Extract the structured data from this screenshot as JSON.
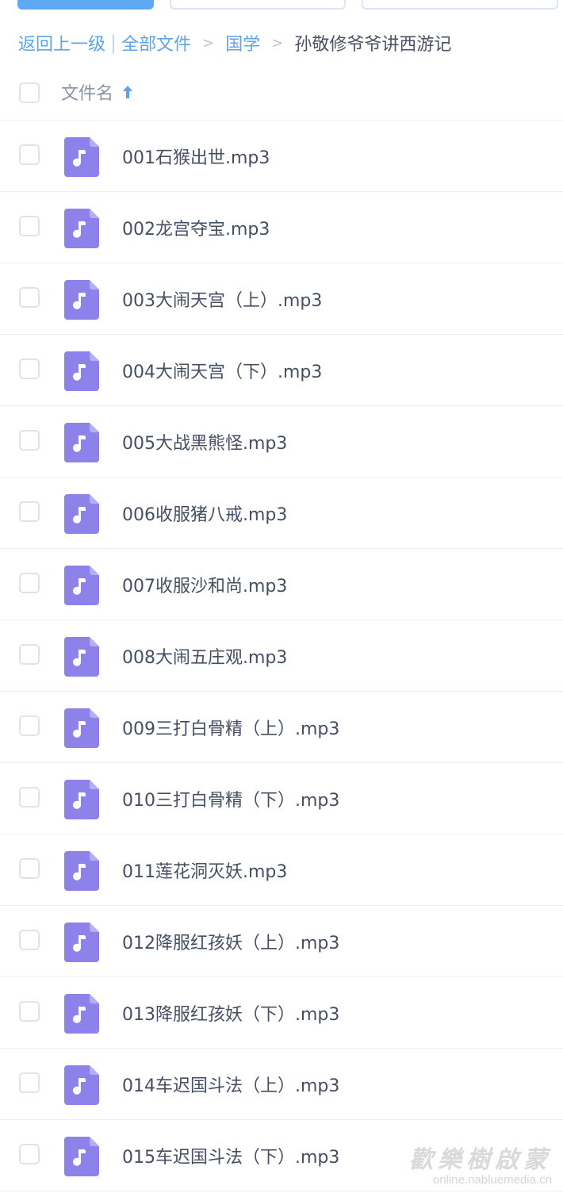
{
  "breadcrumb": {
    "back": "返回上一级",
    "all_files": "全部文件",
    "parent": "国学",
    "current": "孙敬修爷爷讲西游记",
    "separator": ">"
  },
  "header": {
    "name_column": "文件名",
    "sort_icon": "arrow-up-icon"
  },
  "file_icon": "music-file-icon",
  "colors": {
    "accent": "#5ea3ec",
    "file_icon": "#8c82ea"
  },
  "files": [
    {
      "name": "001石猴出世.mp3"
    },
    {
      "name": "002龙宫夺宝.mp3"
    },
    {
      "name": "003大闹天宫（上）.mp3"
    },
    {
      "name": "004大闹天宫（下）.mp3"
    },
    {
      "name": "005大战黑熊怪.mp3"
    },
    {
      "name": "006收服猪八戒.mp3"
    },
    {
      "name": "007收服沙和尚.mp3"
    },
    {
      "name": "008大闹五庄观.mp3"
    },
    {
      "name": "009三打白骨精（上）.mp3"
    },
    {
      "name": "010三打白骨精（下）.mp3"
    },
    {
      "name": "011莲花洞灭妖.mp3"
    },
    {
      "name": "012降服红孩妖（上）.mp3"
    },
    {
      "name": "013降服红孩妖（下）.mp3"
    },
    {
      "name": "014车迟国斗法（上）.mp3"
    },
    {
      "name": "015车迟国斗法（下）.mp3"
    }
  ],
  "watermark": {
    "main": "歡樂樹啟蒙",
    "sub": "online.nabluemedia.cn"
  }
}
